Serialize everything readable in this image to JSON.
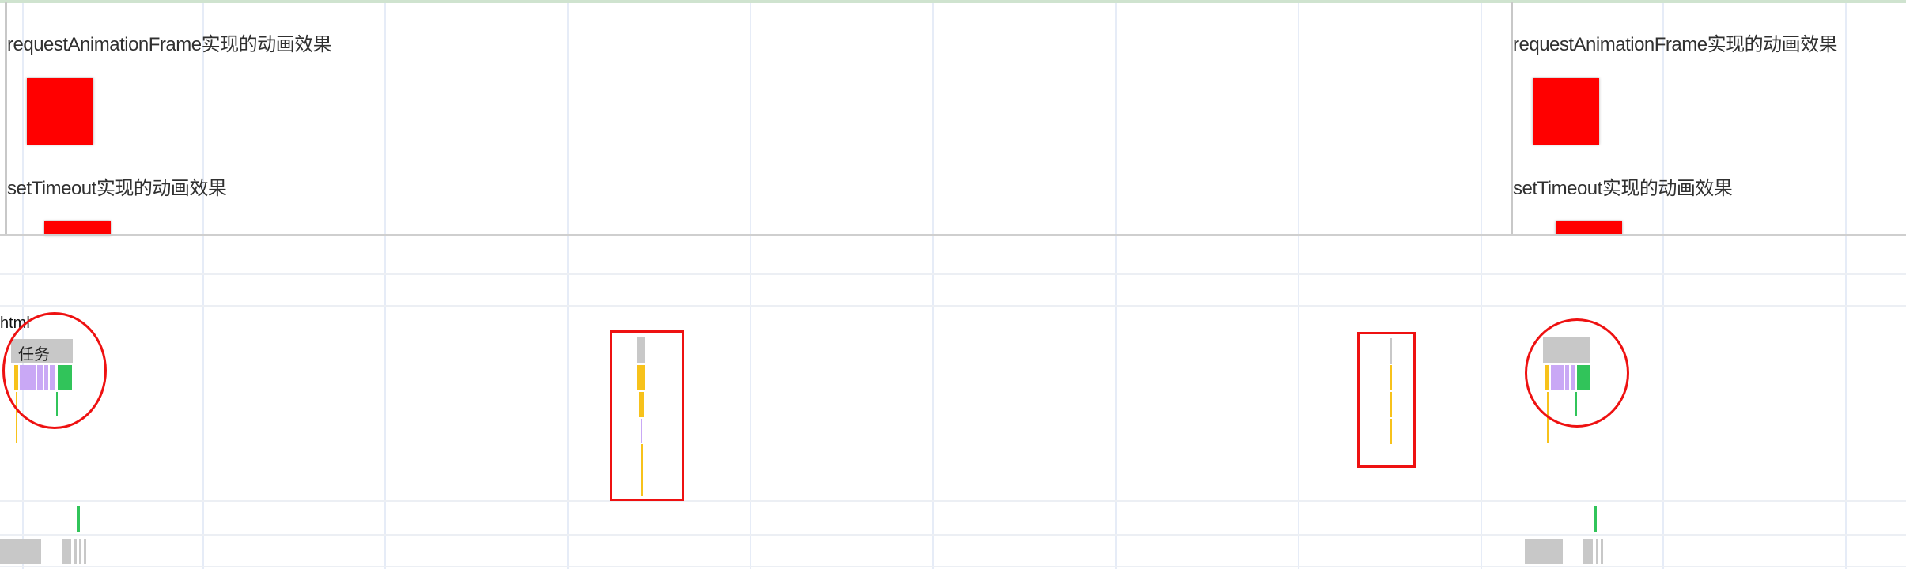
{
  "filmstrip": {
    "frames": [
      {
        "caption_raf": "requestAnimationFrame实现的动画效果",
        "caption_timeout": "setTimeout实现的动画效果"
      },
      {
        "caption_raf": "requestAnimationFrame实现的动画效果",
        "caption_timeout": "setTimeout实现的动画效果"
      }
    ]
  },
  "flame": {
    "thread_label": "html",
    "task_label": "任务"
  },
  "colors": {
    "annotation": "#e11111",
    "box": "#ff0000",
    "scripting": "#f7c21b",
    "rendering": "#c9a8f5",
    "painting": "#31c45a",
    "task": "#c8c8c8"
  }
}
